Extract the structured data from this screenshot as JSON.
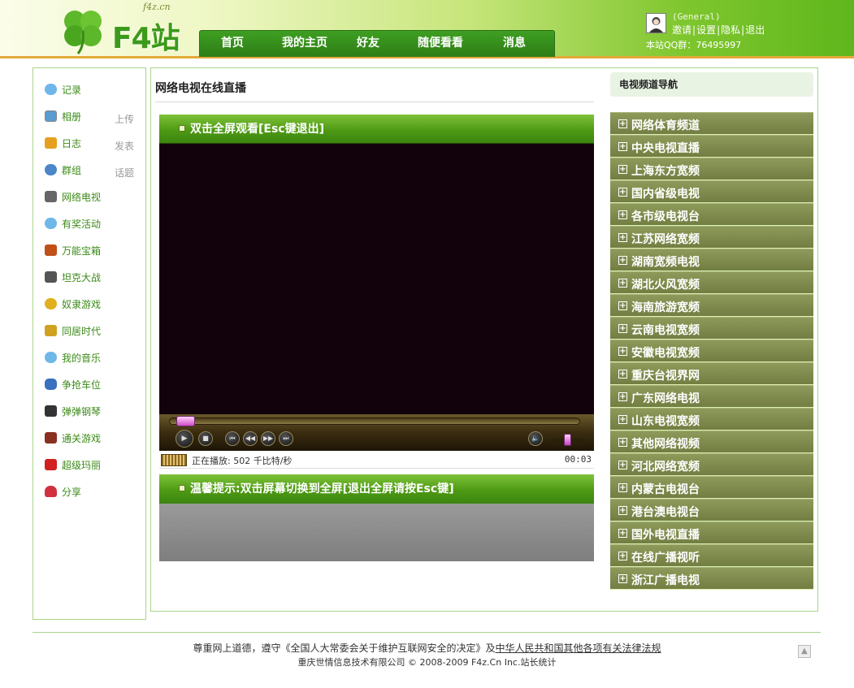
{
  "header": {
    "logo_small": "f4z.cn",
    "logo_text": "F4站",
    "nav": [
      "首页",
      "我的主页",
      "好友",
      "随便看看",
      "消息"
    ],
    "user": {
      "group": "(General)",
      "links": [
        "邀请",
        "设置",
        "隐私",
        "退出"
      ],
      "qq": "本站QQ群：76495997"
    }
  },
  "sidebar": {
    "items": [
      {
        "label": "记录",
        "icon": "chat-bubble-icon",
        "color": "#6fb7e8"
      },
      {
        "label": "相册",
        "icon": "photo-icon",
        "color": "#5a9bd0"
      },
      {
        "label": "日志",
        "icon": "diary-icon",
        "color": "#e5a020"
      },
      {
        "label": "群组",
        "icon": "group-icon",
        "color": "#4a86c8"
      },
      {
        "label": "网络电视",
        "icon": "tv-icon",
        "color": "#666666"
      },
      {
        "label": "有奖活动",
        "icon": "chat-bubble-icon",
        "color": "#6fb7e8"
      },
      {
        "label": "万能宝箱",
        "icon": "treasure-box-icon",
        "color": "#c05018"
      },
      {
        "label": "坦克大战",
        "icon": "tank-icon",
        "color": "#555555"
      },
      {
        "label": "奴隶游戏",
        "icon": "coins-icon",
        "color": "#e0b020"
      },
      {
        "label": "同居时代",
        "icon": "house-icon",
        "color": "#d0a020"
      },
      {
        "label": "我的音乐",
        "icon": "chat-bubble-icon",
        "color": "#6fb7e8"
      },
      {
        "label": "争抢车位",
        "icon": "car-icon",
        "color": "#3a70c0"
      },
      {
        "label": "弹弹钢琴",
        "icon": "piano-icon",
        "color": "#333333"
      },
      {
        "label": "通关游戏",
        "icon": "book-icon",
        "color": "#8a3020"
      },
      {
        "label": "超级玛丽",
        "icon": "mario-icon",
        "color": "#d02020"
      },
      {
        "label": "分享",
        "icon": "heart-icon",
        "color": "#d03040"
      }
    ],
    "actions": {
      "upload": "上传",
      "post": "发表",
      "topic": "话题"
    }
  },
  "main": {
    "title": "网络电视在线直播",
    "bar_top": "双击全屏观看[Esc键退出]",
    "bar_tip": "温馨提示:双击屏幕切换到全屏[退出全屏请按Esc键]",
    "player": {
      "status": "正在播放: 502 千比特/秒",
      "time": "00:03",
      "progress": 0.02
    }
  },
  "channels": {
    "title": "电视频道导航",
    "items": [
      "网络体育频道",
      "中央电视直播",
      "上海东方宽频",
      "国内省级电视",
      "各市级电视台",
      "江苏网络宽频",
      "湖南宽频电视",
      "湖北火风宽频",
      "海南旅游宽频",
      "云南电视宽频",
      "安徽电视宽频",
      "重庆台视界网",
      "广东网络电视",
      "山东电视宽频",
      "其他网络视频",
      "河北网络宽频",
      "内蒙古电视台",
      "港台澳电视台",
      "国外电视直播",
      "在线广播视听",
      "浙江广播电视"
    ]
  },
  "footer": {
    "line1_prefix": "尊重网上道德，遵守《全国人大常委会关于维护互联网安全的决定》及",
    "line1_link": "中华人民共和国其他各项有关法律法规",
    "line2_text": "重庆世情信息技术有限公司 © 2008-2009 F4z.Cn Inc.",
    "line2_link": "站长统计"
  }
}
